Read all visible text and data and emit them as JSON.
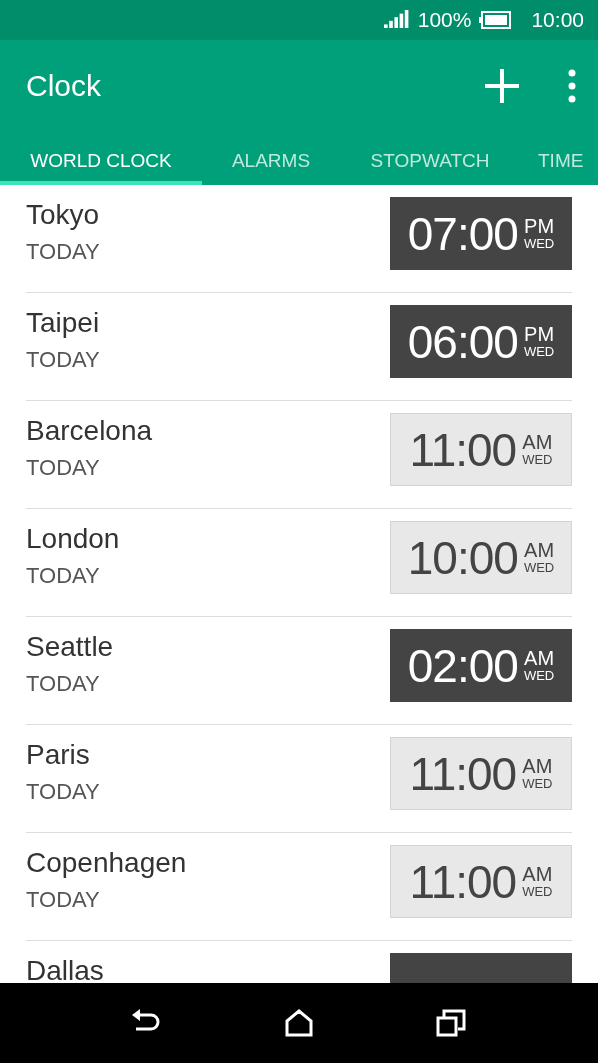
{
  "status_bar": {
    "battery": "100%",
    "time": "10:00"
  },
  "app_bar": {
    "title": "Clock"
  },
  "tabs": [
    {
      "label": "WORLD CLOCK",
      "selected": true
    },
    {
      "label": "ALARMS",
      "selected": false
    },
    {
      "label": "STOPWATCH",
      "selected": false
    },
    {
      "label": "TIME",
      "selected": false
    }
  ],
  "cities": [
    {
      "city": "Tokyo",
      "day": "TODAY",
      "time": "07:00",
      "period": "PM",
      "weekday": "WED",
      "dark": true
    },
    {
      "city": "Taipei",
      "day": "TODAY",
      "time": "06:00",
      "period": "PM",
      "weekday": "WED",
      "dark": true
    },
    {
      "city": "Barcelona",
      "day": "TODAY",
      "time": "11:00",
      "period": "AM",
      "weekday": "WED",
      "dark": false
    },
    {
      "city": "London",
      "day": "TODAY",
      "time": "10:00",
      "period": "AM",
      "weekday": "WED",
      "dark": false
    },
    {
      "city": "Seattle",
      "day": "TODAY",
      "time": "02:00",
      "period": "AM",
      "weekday": "WED",
      "dark": true
    },
    {
      "city": "Paris",
      "day": "TODAY",
      "time": "11:00",
      "period": "AM",
      "weekday": "WED",
      "dark": false
    },
    {
      "city": "Copenhagen",
      "day": "TODAY",
      "time": "11:00",
      "period": "AM",
      "weekday": "WED",
      "dark": false
    },
    {
      "city": "Dallas",
      "dark": true
    }
  ]
}
